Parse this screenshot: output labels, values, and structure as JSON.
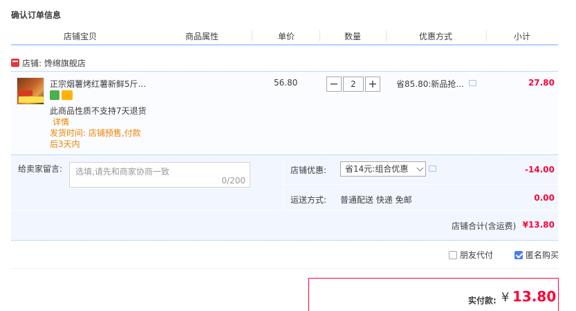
{
  "title": "确认订单信息",
  "columns": [
    "店铺宝贝",
    "商品属性",
    "单价",
    "数量",
    "优惠方式",
    "小计"
  ],
  "shop": {
    "label": "店铺: 馋绵旗舰店"
  },
  "item": {
    "name": "正宗烟薯烤红薯新鲜5斤...",
    "no_return": "此商品性质不支持7天退货",
    "detail_link": "详情",
    "ship_time_line1": "发货时间: 店铺预售,付款",
    "ship_time_line2": "后3天内",
    "unit_price": "56.80",
    "quantity": "2",
    "minus": "−",
    "plus": "+",
    "promo": "省85.80:新品抢...",
    "subtotal": "27.80"
  },
  "message": {
    "label": "给卖家留言:",
    "placeholder": "选填,请先和商家协商一致",
    "count": "0/200"
  },
  "shop_discount": {
    "label": "店铺优惠:",
    "selected": "省14元:组合优惠",
    "amount": "-14.00"
  },
  "shipping": {
    "label": "运送方式:",
    "method": "普通配送 快递 免邮",
    "amount": "0.00"
  },
  "shop_total": {
    "label": "店铺合计(含运费)",
    "amount": "¥13.80"
  },
  "options": {
    "friend_pay": "朋友代付",
    "friend_pay_checked": false,
    "anonymous": "匿名购买",
    "anonymous_checked": true
  },
  "payment": {
    "label": "实付款:",
    "currency": "¥",
    "amount": "13.80"
  },
  "colors": {
    "accent_red": "#ff0036",
    "link_orange": "#f08200",
    "line_blue": "#80b2ff"
  }
}
